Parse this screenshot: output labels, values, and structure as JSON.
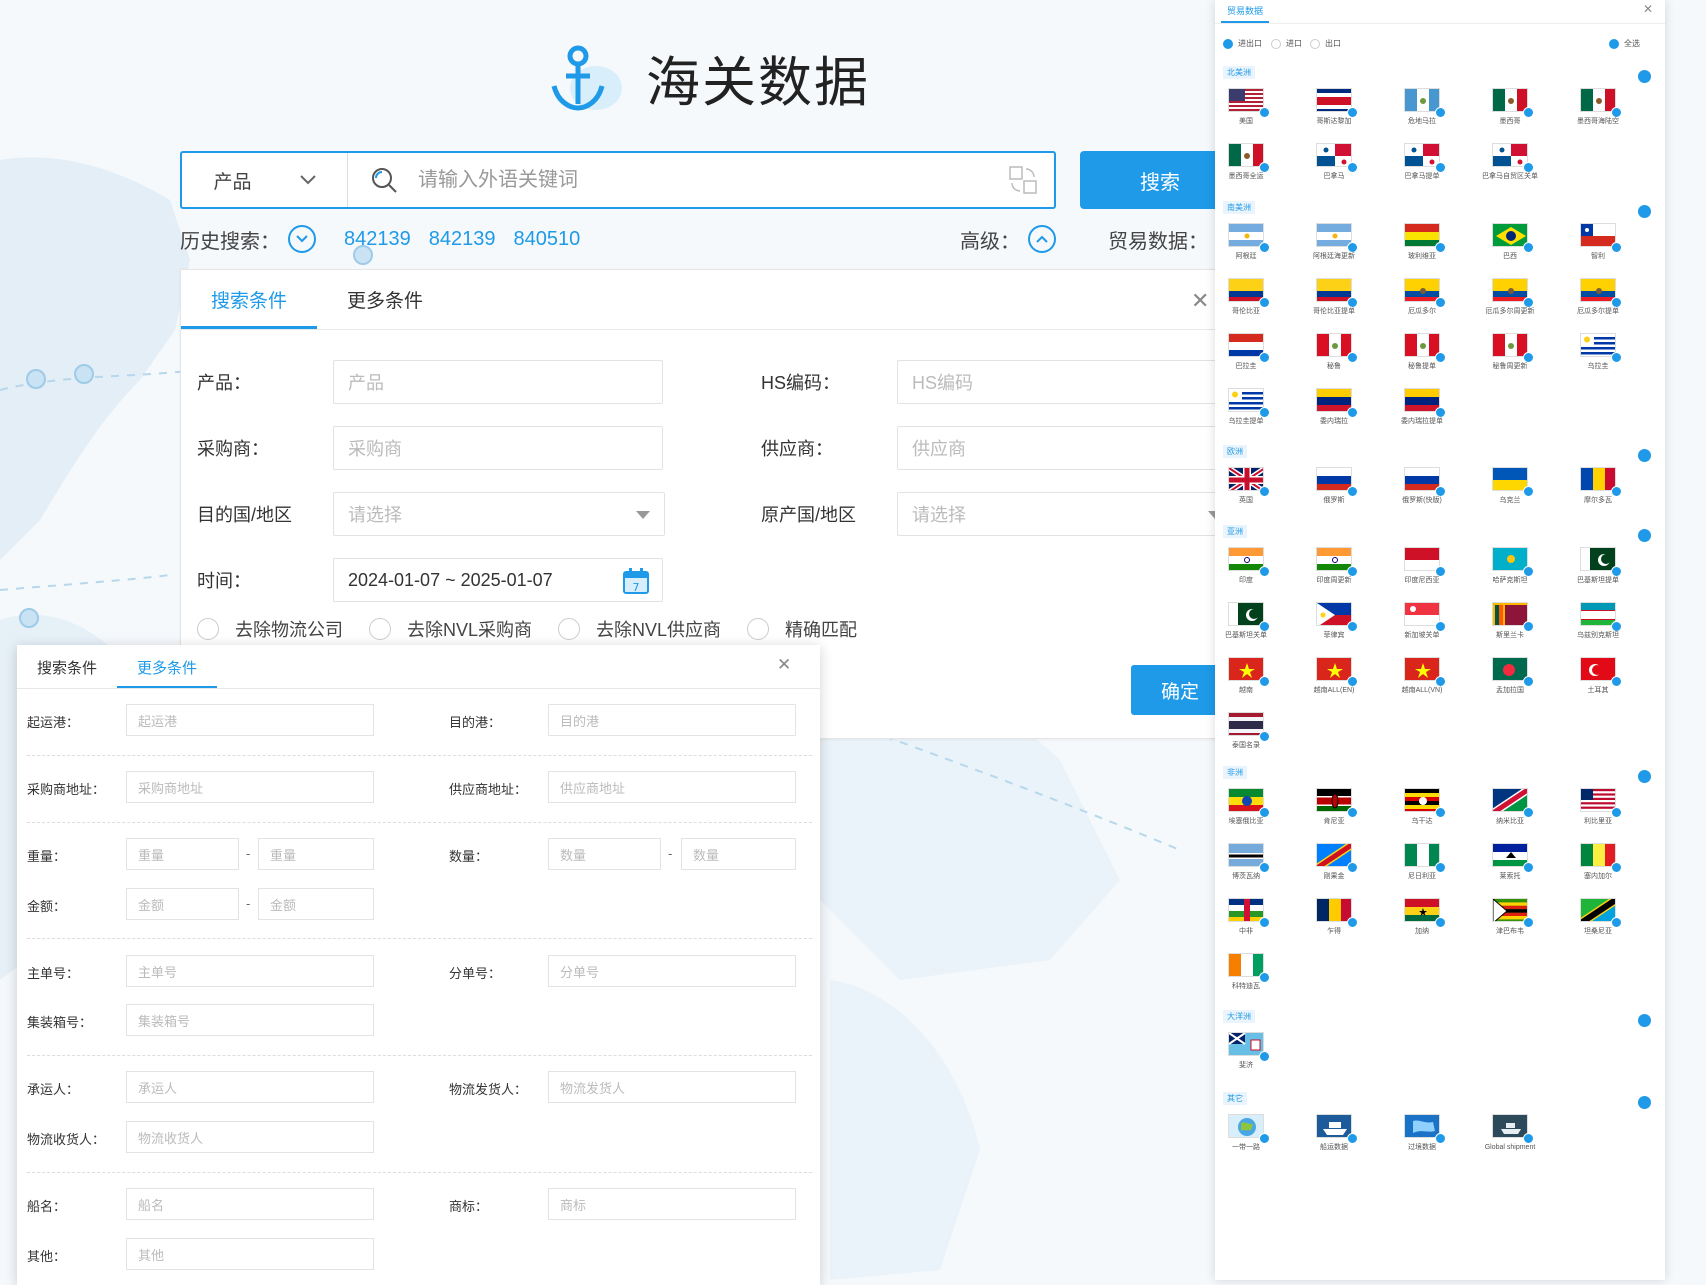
{
  "header": {
    "title": "海关数据"
  },
  "search": {
    "product_select": "产品",
    "placeholder": "请输入外语关键词",
    "button": "搜索"
  },
  "history": {
    "label": "历史搜索：",
    "items": [
      "842139",
      "842139",
      "840510"
    ]
  },
  "advanced": {
    "label": "高级："
  },
  "trade": {
    "label": "贸易数据："
  },
  "panel1": {
    "tabs": [
      "搜索条件",
      "更多条件"
    ],
    "fields": {
      "product": {
        "label": "产品：",
        "placeholder": "产品"
      },
      "hs": {
        "label": "HS编码：",
        "placeholder": "HS编码"
      },
      "buyer": {
        "label": "采购商：",
        "placeholder": "采购商"
      },
      "supplier": {
        "label": "供应商：",
        "placeholder": "供应商"
      },
      "dest": {
        "label": "目的国/地区",
        "placeholder": "请选择"
      },
      "origin": {
        "label": "原产国/地区",
        "placeholder": "请选择"
      },
      "time": {
        "label": "时间：",
        "value": "2024-01-07 ~ 2025-01-07"
      }
    },
    "checks": [
      "去除物流公司",
      "去除NVL采购商",
      "去除NVL供应商",
      "精确匹配"
    ],
    "ok": "确定"
  },
  "panel2": {
    "tabs": [
      "搜索条件",
      "更多条件"
    ],
    "fields": [
      {
        "label": "起运港：",
        "placeholder": "起运港"
      },
      {
        "label": "目的港：",
        "placeholder": "目的港"
      },
      {
        "label": "采购商地址：",
        "placeholder": "采购商地址"
      },
      {
        "label": "供应商地址：",
        "placeholder": "供应商地址"
      },
      {
        "label": "重量：",
        "placeholder": "重量"
      },
      {
        "label": "数量：",
        "placeholder": "数量"
      },
      {
        "label": "金额：",
        "placeholder": "金额"
      },
      {
        "label": "主单号：",
        "placeholder": "主单号"
      },
      {
        "label": "分单号：",
        "placeholder": "分单号"
      },
      {
        "label": "集装箱号：",
        "placeholder": "集装箱号"
      },
      {
        "label": "承运人：",
        "placeholder": "承运人"
      },
      {
        "label": "物流发货人：",
        "placeholder": "物流发货人"
      },
      {
        "label": "物流收货人：",
        "placeholder": "物流收货人"
      },
      {
        "label": "船名：",
        "placeholder": "船名"
      },
      {
        "label": "商标：",
        "placeholder": "商标"
      },
      {
        "label": "其他：",
        "placeholder": "其他"
      }
    ],
    "dash": "-"
  },
  "panel3": {
    "tab": "贸易数据",
    "options": [
      "进出口",
      "进口",
      "出口"
    ],
    "select_all": "全选",
    "regions": [
      {
        "name": "北美洲",
        "countries": [
          {
            "name": "美国",
            "flag": "us"
          },
          {
            "name": "哥斯达黎加",
            "flag": "cr"
          },
          {
            "name": "危地马拉",
            "flag": "gt"
          },
          {
            "name": "墨西哥",
            "flag": "mx"
          },
          {
            "name": "墨西哥海陆空",
            "flag": "mx"
          },
          {
            "name": "墨西哥全运",
            "flag": "mx"
          },
          {
            "name": "巴拿马",
            "flag": "pa"
          },
          {
            "name": "巴拿马提单",
            "flag": "pa"
          },
          {
            "name": "巴拿马自贸区关单",
            "flag": "pa"
          }
        ]
      },
      {
        "name": "南美洲",
        "countries": [
          {
            "name": "阿根廷",
            "flag": "ar"
          },
          {
            "name": "阿根廷海更新",
            "flag": "ar"
          },
          {
            "name": "玻利维亚",
            "flag": "bo"
          },
          {
            "name": "巴西",
            "flag": "br"
          },
          {
            "name": "智利",
            "flag": "cl"
          },
          {
            "name": "哥伦比亚",
            "flag": "co"
          },
          {
            "name": "哥伦比亚提单",
            "flag": "co"
          },
          {
            "name": "厄瓜多尔",
            "flag": "ec"
          },
          {
            "name": "厄瓜多尔周更新",
            "flag": "ec"
          },
          {
            "name": "厄瓜多尔提单",
            "flag": "ec"
          },
          {
            "name": "巴拉圭",
            "flag": "py"
          },
          {
            "name": "秘鲁",
            "flag": "pe"
          },
          {
            "name": "秘鲁提单",
            "flag": "pe"
          },
          {
            "name": "秘鲁周更新",
            "flag": "pe"
          },
          {
            "name": "乌拉圭",
            "flag": "uy"
          },
          {
            "name": "乌拉圭提单",
            "flag": "uy"
          },
          {
            "name": "委内瑞拉",
            "flag": "ve"
          },
          {
            "name": "委内瑞拉提单",
            "flag": "ve"
          }
        ]
      },
      {
        "name": "欧洲",
        "countries": [
          {
            "name": "英国",
            "flag": "gb"
          },
          {
            "name": "俄罗斯",
            "flag": "ru"
          },
          {
            "name": "俄罗斯(快版)",
            "flag": "ru"
          },
          {
            "name": "乌克兰",
            "flag": "ua"
          },
          {
            "name": "摩尔多瓦",
            "flag": "md"
          }
        ]
      },
      {
        "name": "亚洲",
        "countries": [
          {
            "name": "印度",
            "flag": "in"
          },
          {
            "name": "印度周更新",
            "flag": "in"
          },
          {
            "name": "印度尼西亚",
            "flag": "id"
          },
          {
            "name": "哈萨克斯坦",
            "flag": "kz"
          },
          {
            "name": "巴基斯坦提单",
            "flag": "pk"
          },
          {
            "name": "巴基斯坦关单",
            "flag": "pk"
          },
          {
            "name": "菲律宾",
            "flag": "ph"
          },
          {
            "name": "新加坡关单",
            "flag": "sg"
          },
          {
            "name": "斯里兰卡",
            "flag": "lk"
          },
          {
            "name": "乌兹别克斯坦",
            "flag": "uz"
          },
          {
            "name": "越南",
            "flag": "vn"
          },
          {
            "name": "越南ALL(EN)",
            "flag": "vn"
          },
          {
            "name": "越南ALL(VN)",
            "flag": "vn"
          },
          {
            "name": "孟加拉国",
            "flag": "bd"
          },
          {
            "name": "土耳其",
            "flag": "tr"
          },
          {
            "name": "泰国名录",
            "flag": "th"
          }
        ]
      },
      {
        "name": "非洲",
        "countries": [
          {
            "name": "埃塞俄比亚",
            "flag": "et"
          },
          {
            "name": "肯尼亚",
            "flag": "ke"
          },
          {
            "name": "乌干达",
            "flag": "ug"
          },
          {
            "name": "纳米比亚",
            "flag": "na"
          },
          {
            "name": "利比里亚",
            "flag": "lr"
          },
          {
            "name": "博茨瓦纳",
            "flag": "bw"
          },
          {
            "name": "刚果金",
            "flag": "cd"
          },
          {
            "name": "尼日利亚",
            "flag": "ng"
          },
          {
            "name": "莱索托",
            "flag": "ls"
          },
          {
            "name": "塞内加尔",
            "flag": "sn"
          },
          {
            "name": "中非",
            "flag": "cf"
          },
          {
            "name": "乍得",
            "flag": "td"
          },
          {
            "name": "加纳",
            "flag": "gh"
          },
          {
            "name": "津巴布韦",
            "flag": "zw"
          },
          {
            "name": "坦桑尼亚",
            "flag": "tz"
          },
          {
            "name": "科特迪瓦",
            "flag": "ci"
          }
        ]
      },
      {
        "name": "大洋洲",
        "countries": [
          {
            "name": "斐济",
            "flag": "fj"
          }
        ]
      },
      {
        "name": "其它",
        "countries": [
          {
            "name": "一带一路",
            "flag": "globe"
          },
          {
            "name": "船运数据",
            "flag": "ship"
          },
          {
            "name": "过境数据",
            "flag": "map"
          },
          {
            "name": "Global shipment",
            "flag": "ship2"
          }
        ]
      }
    ]
  },
  "colors": {
    "accent": "#1e9ae8"
  }
}
